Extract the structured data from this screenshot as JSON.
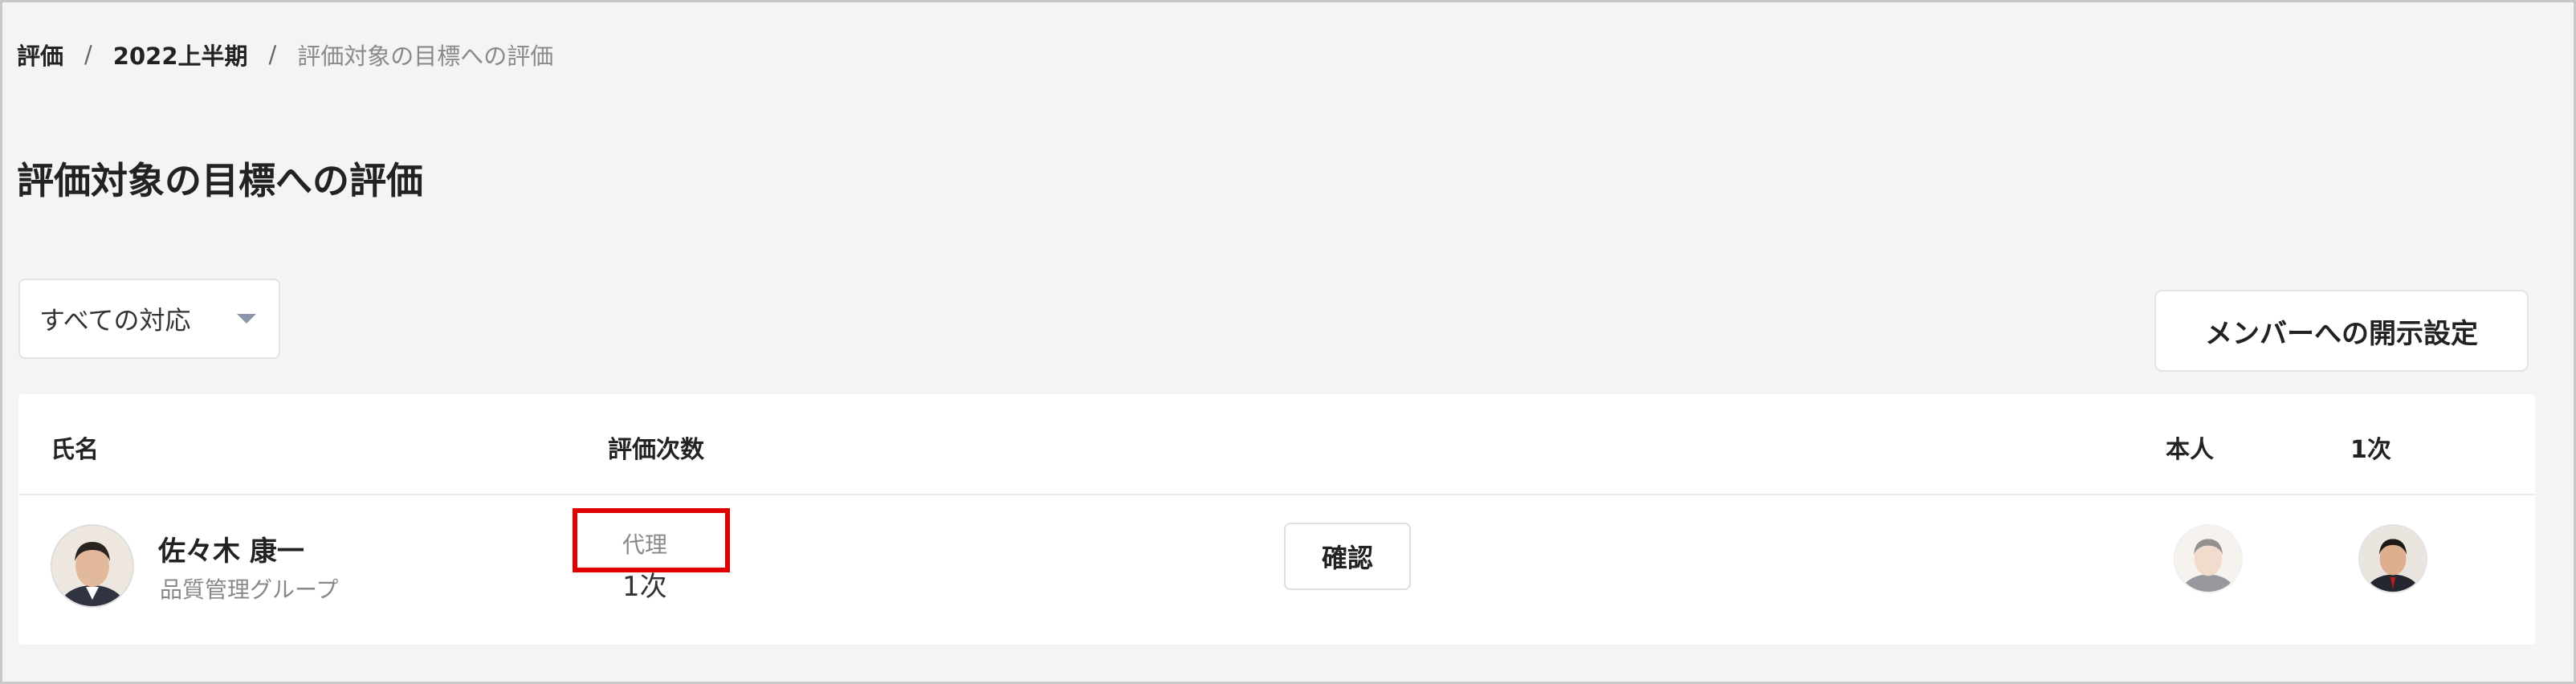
{
  "breadcrumb": {
    "items": [
      "評価",
      "2022上半期",
      "評価対象の目標への評価"
    ],
    "separator": "/"
  },
  "page": {
    "title": "評価対象の目標への評価"
  },
  "filter": {
    "selected": "すべての対応"
  },
  "actions": {
    "disclosure_button": "メンバーへの開示設定"
  },
  "table": {
    "headers": {
      "name": "氏名",
      "eval_count": "評価次数",
      "self": "本人",
      "first": "1次"
    },
    "rows": [
      {
        "name": "佐々木 康一",
        "group": "品質管理グループ",
        "proxy_label": "代理",
        "eval_count": "1次",
        "confirm_label": "確認"
      }
    ]
  },
  "colors": {
    "highlight": "#e00000",
    "accent_caret": "#8b96ad",
    "background": "#f3f4f6"
  }
}
